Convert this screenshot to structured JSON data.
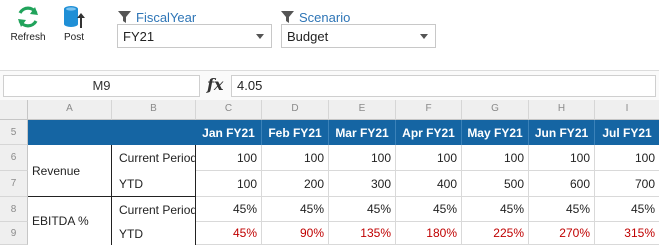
{
  "toolbar": {
    "refresh_label": "Refresh",
    "post_label": "Post",
    "filters": [
      {
        "label": "FiscalYear",
        "value": "FY21"
      },
      {
        "label": "Scenario",
        "value": "Budget"
      }
    ]
  },
  "formula_bar": {
    "name_box": "M9",
    "fx_label": "fx",
    "value": "4.05"
  },
  "grid": {
    "column_headers": [
      "A",
      "B",
      "C",
      "D",
      "E",
      "F",
      "G",
      "H",
      "I"
    ],
    "row_headers": [
      "5",
      "6",
      "7",
      "8",
      "9"
    ],
    "months": [
      "Jan FY21",
      "Feb FY21",
      "Mar FY21",
      "Apr FY21",
      "May FY21",
      "Jun FY21",
      "Jul FY21"
    ],
    "rows": [
      {
        "metric": "Revenue",
        "period": "Current Period",
        "values": [
          "100",
          "100",
          "100",
          "100",
          "100",
          "100",
          "100"
        ]
      },
      {
        "metric": "",
        "period": "YTD",
        "values": [
          "100",
          "200",
          "300",
          "400",
          "500",
          "600",
          "700"
        ]
      },
      {
        "metric": "EBITDA %",
        "period": "Current Period",
        "values": [
          "45%",
          "45%",
          "45%",
          "45%",
          "45%",
          "45%",
          "45%"
        ]
      },
      {
        "metric": "",
        "period": "YTD",
        "values": [
          "45%",
          "90%",
          "135%",
          "180%",
          "225%",
          "270%",
          "315%"
        ]
      }
    ]
  },
  "colors": {
    "header_band": "#1565a3",
    "accent_blue": "#2e75b6",
    "negative_red": "#c00000",
    "refresh_green": "#21a35b",
    "post_blue": "#1f8fd6"
  }
}
